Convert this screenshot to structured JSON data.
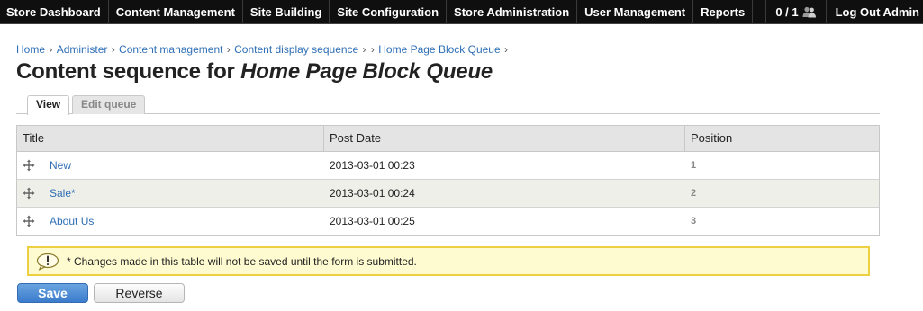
{
  "admin_menu": {
    "items": [
      {
        "label": "Store Dashboard"
      },
      {
        "label": "Content Management"
      },
      {
        "label": "Site Building"
      },
      {
        "label": "Site Configuration"
      },
      {
        "label": "Store Administration"
      },
      {
        "label": "User Management"
      },
      {
        "label": "Reports"
      }
    ],
    "users_count": "0 / 1",
    "users_icon": "users-icon",
    "logout_label": "Log Out Admin"
  },
  "breadcrumb": {
    "items": [
      {
        "label": "Home"
      },
      {
        "label": "Administer"
      },
      {
        "label": "Content management"
      },
      {
        "label": "Content display sequence"
      },
      {
        "label": ""
      },
      {
        "label": "Home Page Block Queue"
      }
    ],
    "separator": "›"
  },
  "page": {
    "title_prefix": "Content sequence for",
    "title_queue": "Home Page Block Queue"
  },
  "tabs": [
    {
      "label": "View",
      "active": true
    },
    {
      "label": "Edit queue",
      "active": false
    }
  ],
  "table": {
    "headers": {
      "title": "Title",
      "post_date": "Post Date",
      "position": "Position"
    },
    "rows": [
      {
        "title": "New",
        "marker": "",
        "post_date": "2013-03-01 00:23",
        "position": "1"
      },
      {
        "title": "Sale",
        "marker": "*",
        "post_date": "2013-03-01 00:24",
        "position": "2"
      },
      {
        "title": "About Us",
        "marker": "",
        "post_date": "2013-03-01 00:25",
        "position": "3"
      }
    ],
    "drag_icon": "drag-handle-icon"
  },
  "warning": {
    "marker": "*",
    "text": "Changes made in this table will not be saved until the form is submitted.",
    "icon": "warning-icon"
  },
  "buttons": {
    "save_label": "Save",
    "reverse_label": "Reverse"
  },
  "colors": {
    "admin_bar": "#0f0f0f",
    "link": "#2f6fb5",
    "warning_bg": "#fdfbcf",
    "warning_border": "#edcf42",
    "save_button": "#3a7bcc"
  }
}
